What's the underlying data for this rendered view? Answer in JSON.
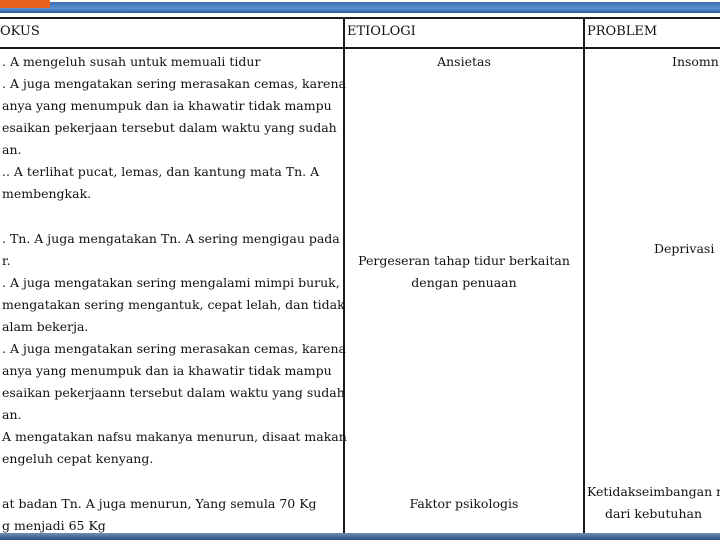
{
  "table": {
    "headers": {
      "fokus": "OKUS",
      "etiologi": "ETIOLOGI",
      "problem": "PROBLEM"
    },
    "rows": [
      {
        "fokus_lines": [
          ". A mengeluh susah untuk memuali tidur",
          ". A juga mengatakan sering merasakan cemas, karena",
          "anya yang menumpuk dan ia khawatir tidak mampu",
          "esaikan pekerjaan tersebut dalam waktu yang sudah",
          "an.",
          "..  A terlihat pucat, lemas, dan kantung mata Tn. A",
          "membengkak."
        ],
        "etiologi": "Ansietas",
        "problem": "Insomn"
      },
      {
        "fokus_lines": [
          ". Tn. A juga mengatakan Tn. A sering mengigau pada",
          "r.",
          ". A juga mengatakan sering mengalami mimpi buruk,",
          "mengatakan sering mengantuk, cepat lelah, dan tidak",
          "alam bekerja.",
          ". A juga mengatakan sering merasakan cemas, karena",
          "anya yang menumpuk dan ia khawatir tidak mampu",
          "esaikan pekerjaann tersebut dalam waktu yang sudah",
          "an.",
          "A mengatakan nafsu makanya menurun, disaat makan",
          "engeluh cepat kenyang."
        ],
        "etiologi_lines": [
          "Pergeseran tahap tidur berkaitan",
          "dengan penuaan"
        ],
        "problem": "Deprivasi "
      },
      {
        "fokus_lines": [
          "at badan Tn. A juga menurun, Yang semula 70 Kg",
          "g menjadi 65 Kg"
        ],
        "etiologi": "Faktor psikologis",
        "problem_lines": [
          "Ketidakseimbangan n",
          "dari kebutuhan"
        ]
      }
    ]
  }
}
